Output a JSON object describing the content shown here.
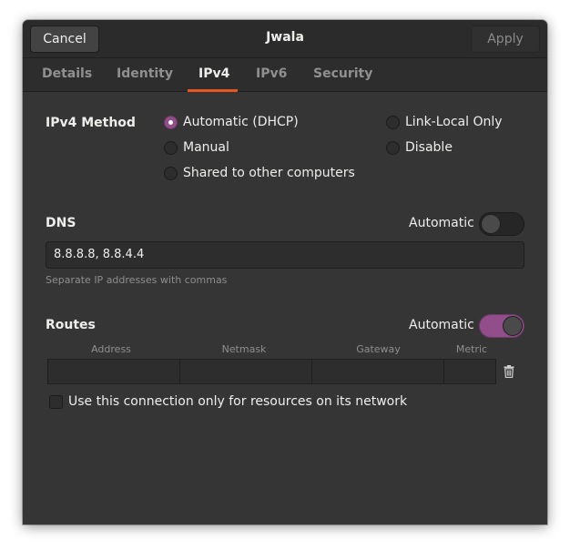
{
  "header": {
    "cancel_label": "Cancel",
    "title": "Jwala",
    "apply_label": "Apply"
  },
  "tabs": [
    {
      "label": "Details"
    },
    {
      "label": "Identity"
    },
    {
      "label": "IPv4",
      "active": true
    },
    {
      "label": "IPv6"
    },
    {
      "label": "Security"
    }
  ],
  "ipv4_method": {
    "label": "IPv4 Method",
    "options": [
      {
        "label": "Automatic (DHCP)",
        "checked": true
      },
      {
        "label": "Manual",
        "checked": false
      },
      {
        "label": "Shared to other computers",
        "checked": false
      },
      {
        "label": "Link-Local Only",
        "checked": false
      },
      {
        "label": "Disable",
        "checked": false
      }
    ]
  },
  "dns": {
    "label": "DNS",
    "automatic_label": "Automatic",
    "automatic": false,
    "value": "8.8.8.8, 8.8.4.4",
    "hint": "Separate IP addresses with commas"
  },
  "routes": {
    "label": "Routes",
    "automatic_label": "Automatic",
    "automatic": true,
    "columns": [
      "Address",
      "Netmask",
      "Gateway",
      "Metric"
    ],
    "row": {
      "address": "",
      "netmask": "",
      "gateway": "",
      "metric": ""
    },
    "only_resources_label": "Use this connection only for resources on its network",
    "only_resources_checked": false
  },
  "colors": {
    "accent_orange": "#e95420",
    "accent_purple": "#924d8b",
    "background": "#353535"
  },
  "icons": {
    "delete_route": "trash-icon"
  }
}
